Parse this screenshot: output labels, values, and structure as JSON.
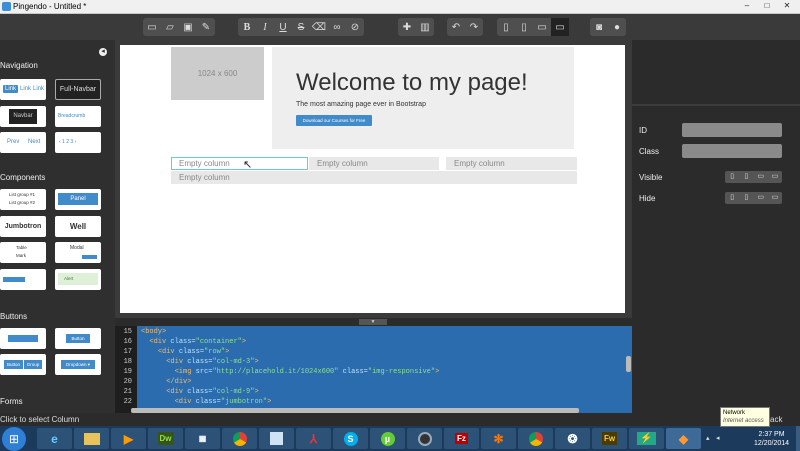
{
  "window": {
    "title": "Pingendo - Untitled *",
    "controls": [
      "–",
      "□",
      "✕"
    ]
  },
  "toolbar": {
    "file_icons": [
      "new-file-icon",
      "open-folder-icon",
      "save-icon",
      "edit-pencil-icon"
    ],
    "format_glyphs": {
      "bold": "B",
      "italic": "I",
      "underline": "U",
      "strike": "S"
    },
    "device_icons": [
      "phone-icon",
      "tablet-icon",
      "laptop-icon",
      "desktop-icon"
    ],
    "active_device": "desktop"
  },
  "left_panel": {
    "sections": {
      "navigation": "Navigation",
      "components": "Components",
      "buttons": "Buttons",
      "forms": "Forms"
    },
    "navigation_items": {
      "link_a": "Link",
      "link_b": "Link",
      "link_c": "Link",
      "full_navbar": "Full-Navbar",
      "navbar": "Navbar",
      "breadcrumb": "Breadcrumb",
      "prev": "Prev",
      "next": "Next"
    },
    "component_items": {
      "list_group_1": "List group #1",
      "list_group_2": "List group #2",
      "panel": "Panel",
      "jumbotron": "Jumbotron",
      "well": "Well",
      "table": "Table",
      "mark": "Mark",
      "modal": "Modal",
      "alert": "Alert"
    },
    "button_items": {
      "button": "Button",
      "group": "Group",
      "dropdown": "Dropdown ▾"
    }
  },
  "canvas": {
    "image_placeholder": "1024 x 600",
    "jumbotron": {
      "heading": "Welcome to my page!",
      "lead": "The most amazing page ever in Bootstrap",
      "button": "Download our Courses for Free"
    },
    "columns": [
      "Empty column",
      "Empty column",
      "Empty column",
      "Empty column"
    ]
  },
  "right_panel": {
    "id_label": "ID",
    "class_label": "Class",
    "visible_label": "Visible",
    "hide_label": "Hide",
    "id_value": "",
    "class_value": ""
  },
  "code": {
    "lines": [
      {
        "n": "15",
        "indent": "",
        "html": [
          [
            "tag",
            "<body>"
          ]
        ]
      },
      {
        "n": "16",
        "indent": "  ",
        "html": [
          [
            "tag",
            "<div "
          ],
          [
            "atn",
            "class="
          ],
          [
            "str",
            "\"container\""
          ],
          [
            "tag",
            ">"
          ]
        ]
      },
      {
        "n": "17",
        "indent": "    ",
        "html": [
          [
            "tag",
            "<div "
          ],
          [
            "atn",
            "class="
          ],
          [
            "str",
            "\"row\""
          ],
          [
            "tag",
            ">"
          ]
        ]
      },
      {
        "n": "18",
        "indent": "      ",
        "html": [
          [
            "tag",
            "<div "
          ],
          [
            "atn",
            "class="
          ],
          [
            "str",
            "\"col-md-3\""
          ],
          [
            "tag",
            ">"
          ]
        ]
      },
      {
        "n": "19",
        "indent": "        ",
        "html": [
          [
            "tag",
            "<img "
          ],
          [
            "atn",
            "src="
          ],
          [
            "str",
            "\"http://placehold.it/1024x600\""
          ],
          [
            "atn",
            " class="
          ],
          [
            "str",
            "\"img-responsive\""
          ],
          [
            "tag",
            ">"
          ]
        ]
      },
      {
        "n": "20",
        "indent": "      ",
        "html": [
          [
            "tag",
            "</div>"
          ]
        ]
      },
      {
        "n": "21",
        "indent": "      ",
        "html": [
          [
            "tag",
            "<div "
          ],
          [
            "atn",
            "class="
          ],
          [
            "str",
            "\"col-md-9\""
          ],
          [
            "tag",
            ">"
          ]
        ]
      },
      {
        "n": "22",
        "indent": "        ",
        "html": [
          [
            "tag",
            "<div "
          ],
          [
            "atn",
            "class="
          ],
          [
            "str",
            "\"jumbotron\""
          ],
          [
            "tag",
            ">"
          ]
        ]
      }
    ]
  },
  "status": {
    "message": "Click to select Column",
    "back": "ack"
  },
  "taskbar": {
    "apps": [
      "Dw",
      "Fw"
    ],
    "tooltip_title": "Network",
    "tooltip_sub": "Internet access",
    "time": "2:37 PM",
    "date": "12/20/2014"
  }
}
